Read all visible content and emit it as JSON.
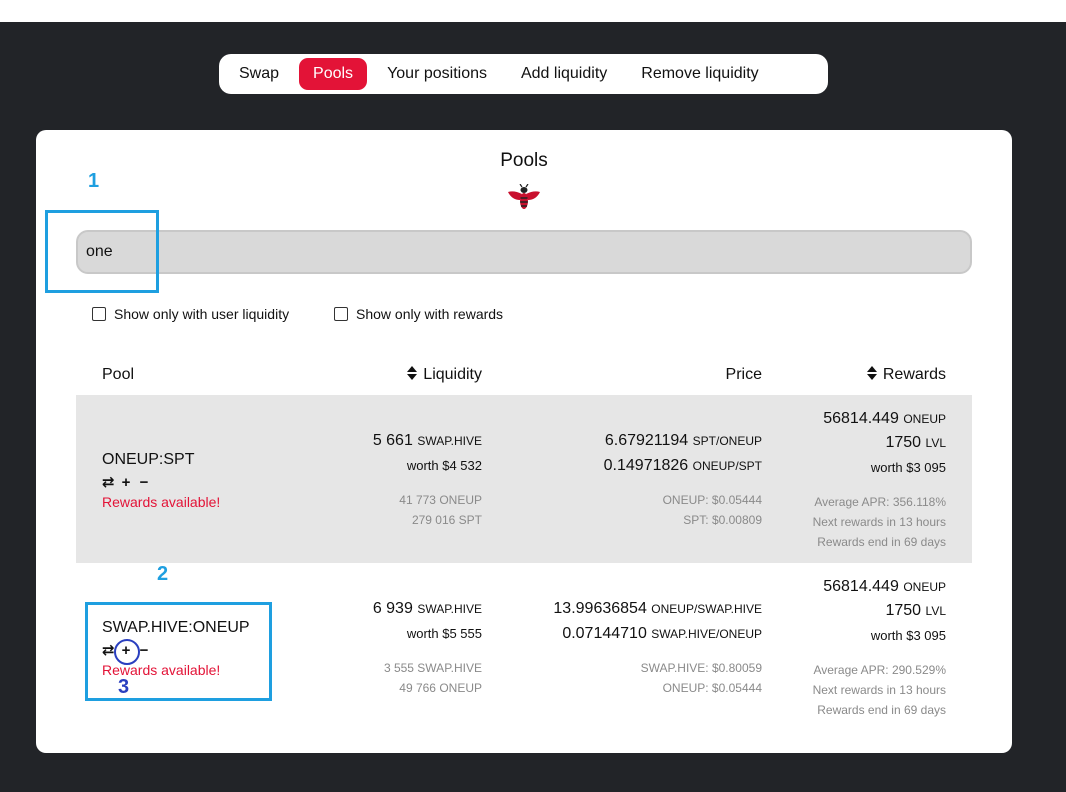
{
  "nav": {
    "items": [
      {
        "label": "Swap",
        "active": false
      },
      {
        "label": "Pools",
        "active": true
      },
      {
        "label": "Your positions",
        "active": false
      },
      {
        "label": "Add liquidity",
        "active": false
      },
      {
        "label": "Remove liquidity",
        "active": false
      }
    ]
  },
  "card": {
    "title": "Pools",
    "logo_icon": "bee-icon",
    "search": {
      "value": "one",
      "placeholder": ""
    },
    "filters": {
      "user_liquidity": "Show only with user liquidity",
      "rewards": "Show only with rewards"
    },
    "columns": {
      "pool": "Pool",
      "liquidity": "Liquidity",
      "price": "Price",
      "rewards": "Rewards"
    }
  },
  "rows": [
    {
      "pool": "ONEUP:SPT",
      "actions": {
        "swap": "⇄",
        "add": "+",
        "remove": "−"
      },
      "rewards_available": "Rewards available!",
      "liquidity": {
        "amount": "5 661",
        "unit": "SWAP.HIVE",
        "worth": "worth $4 532",
        "base": "41 773 ONEUP",
        "quote": "279 016 SPT"
      },
      "price": {
        "p1": "6.67921194",
        "p1_unit": "SPT/ONEUP",
        "p2": "0.14971826",
        "p2_unit": "ONEUP/SPT",
        "usd1": "ONEUP: $0.05444",
        "usd2": "SPT: $0.00809"
      },
      "rewards": {
        "r1": "56814.449",
        "r1_unit": "ONEUP",
        "r2": "1750",
        "r2_unit": "LVL",
        "worth": "worth $3 095",
        "apr": "Average APR: 356.118%",
        "next": "Next rewards in 13 hours",
        "end": "Rewards end in 69 days"
      }
    },
    {
      "pool": "SWAP.HIVE:ONEUP",
      "actions": {
        "swap": "⇄",
        "add": "+",
        "remove": "−"
      },
      "rewards_available": "Rewards available!",
      "liquidity": {
        "amount": "6 939",
        "unit": "SWAP.HIVE",
        "worth": "worth $5 555",
        "base": "3 555 SWAP.HIVE",
        "quote": "49 766 ONEUP"
      },
      "price": {
        "p1": "13.99636854",
        "p1_unit": "ONEUP/SWAP.HIVE",
        "p2": "0.07144710",
        "p2_unit": "SWAP.HIVE/ONEUP",
        "usd1": "SWAP.HIVE: $0.80059",
        "usd2": "ONEUP: $0.05444"
      },
      "rewards": {
        "r1": "56814.449",
        "r1_unit": "ONEUP",
        "r2": "1750",
        "r2_unit": "LVL",
        "worth": "worth $3 095",
        "apr": "Average APR: 290.529%",
        "next": "Next rewards in 13 hours",
        "end": "Rewards end in 69 days"
      }
    }
  ],
  "annotations": {
    "n1": "1",
    "n2": "2",
    "n3": "3"
  },
  "colors": {
    "accent": "#e31337",
    "annotation": "#1e9fe0",
    "background": "#222428"
  }
}
